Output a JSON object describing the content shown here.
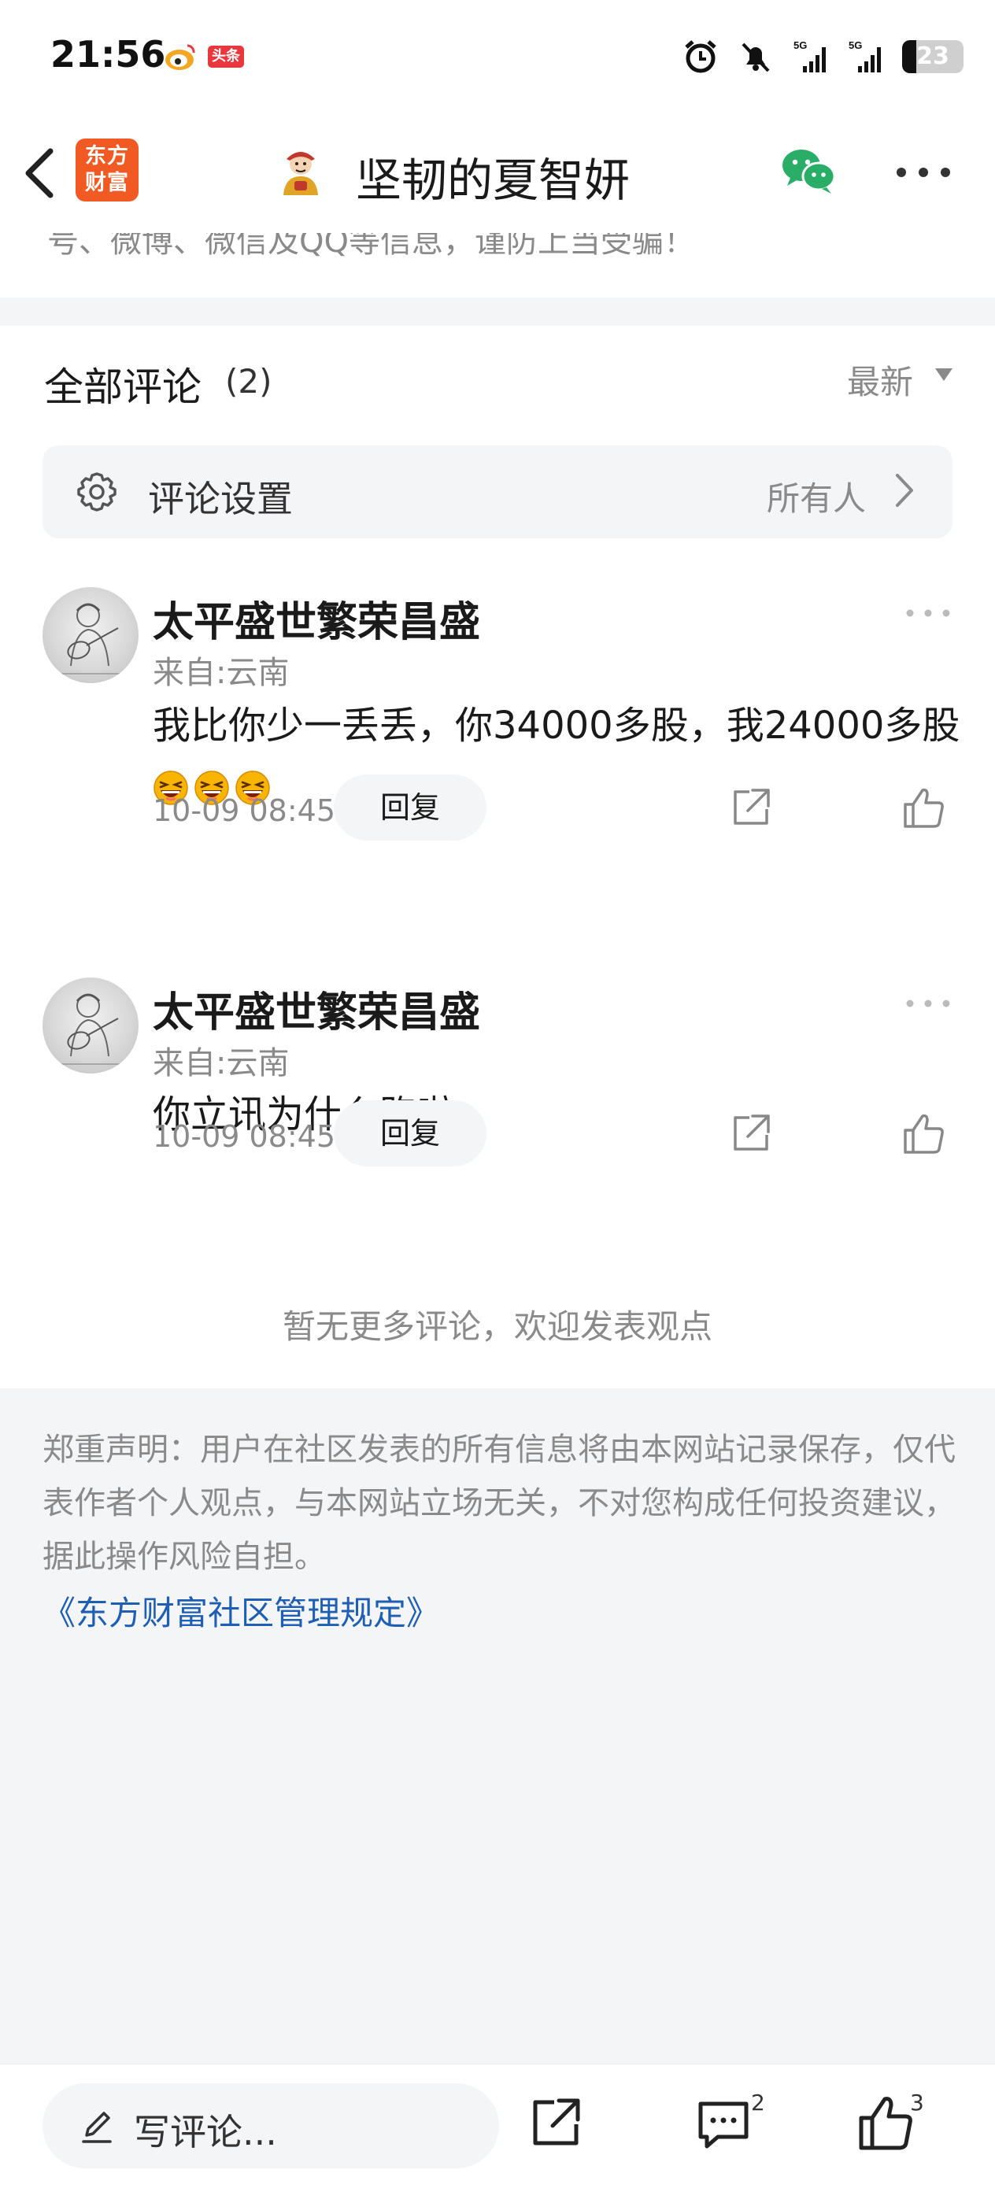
{
  "status_bar": {
    "time": "21:56",
    "toutiao_label": "头条",
    "battery_level": "23",
    "signal_label_1": "5G",
    "signal_label_2": "5G"
  },
  "nav": {
    "logo_text": "东方\n财富",
    "title": "坚韧的夏智妍"
  },
  "notice": {
    "text": "号、微博、微信及QQ等信息，谨防上当受骗！"
  },
  "comments_section": {
    "title": "全部评论",
    "count": "(2)",
    "sort_label": "最新",
    "settings": {
      "label": "评论设置",
      "value": "所有人"
    },
    "items": [
      {
        "author": "太平盛世繁荣昌盛",
        "location": "来自:云南",
        "content": "我比你少一丢丢，你34000多股，我24000多股",
        "emoji_count": 3,
        "time": "10-09 08:45",
        "reply_label": "回复"
      },
      {
        "author": "太平盛世繁荣昌盛",
        "location": "来自:云南",
        "content": "你立讯为什么跑啦",
        "time": "10-09 08:45",
        "reply_label": "回复"
      }
    ],
    "no_more": "暂无更多评论，欢迎发表观点"
  },
  "disclaimer": {
    "text": "郑重声明：用户在社区发表的所有信息将由本网站记录保存，仅代表作者个人观点，与本网站立场无关，不对您构成任何投资建议，据此操作风险自担。",
    "rules_link": "《东方财富社区管理规定》"
  },
  "bottom_bar": {
    "placeholder": "写评论...",
    "comment_count": "2",
    "like_count": "3"
  },
  "colors": {
    "accent_orange": "#f15a22",
    "link_blue": "#1e5fb3",
    "wechat_green": "#2aae67",
    "muted_text": "#8a8a8a"
  },
  "icons": [
    "weibo-icon",
    "alarm-icon",
    "mute-icon",
    "signal-icon",
    "battery-icon",
    "back-icon",
    "wechat-icon",
    "more-icon",
    "gear-icon",
    "chevron-right-icon",
    "share-icon",
    "like-icon",
    "pen-icon",
    "comment-icon"
  ]
}
